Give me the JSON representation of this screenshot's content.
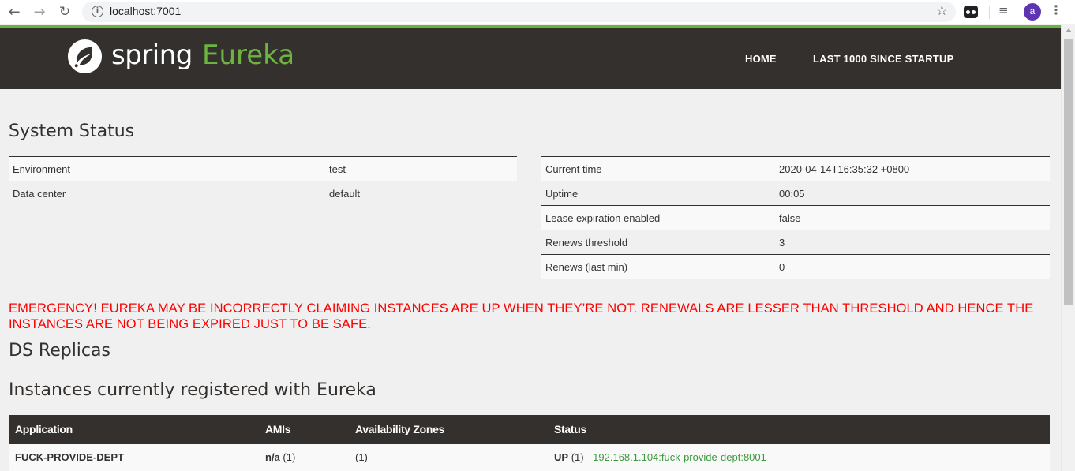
{
  "browser": {
    "url": "localhost:7001",
    "avatar_letter": "a",
    "icons": [
      "back-arrow-icon",
      "forward-arrow-icon",
      "reload-icon",
      "info-icon",
      "star-icon",
      "extension-icon",
      "media-queue-icon",
      "menu-kebab-icon"
    ]
  },
  "header": {
    "logo_spring": "spring",
    "logo_eureka": "Eureka",
    "nav": {
      "home": "HOME",
      "last1000": "LAST 1000 SINCE STARTUP"
    }
  },
  "colors": {
    "brand_green": "#6db33f",
    "header_bg": "#34302d",
    "emergency_red": "#ff0000",
    "link_green": "#3d9b3d"
  },
  "system_status": {
    "title": "System Status",
    "left": [
      {
        "key": "Environment",
        "value": "test"
      },
      {
        "key": "Data center",
        "value": "default"
      }
    ],
    "right": [
      {
        "key": "Current time",
        "value": "2020-04-14T16:35:32 +0800"
      },
      {
        "key": "Uptime",
        "value": "00:05"
      },
      {
        "key": "Lease expiration enabled",
        "value": "false"
      },
      {
        "key": "Renews threshold",
        "value": "3"
      },
      {
        "key": "Renews (last min)",
        "value": "0"
      }
    ]
  },
  "emergency": "EMERGENCY! EUREKA MAY BE INCORRECTLY CLAIMING INSTANCES ARE UP WHEN THEY’RE NOT. RENEWALS ARE LESSER THAN THRESHOLD AND HENCE THE INSTANCES ARE NOT BEING EXPIRED JUST TO BE SAFE.",
  "ds_replicas": {
    "title": "DS Replicas"
  },
  "instances": {
    "title": "Instances currently registered with Eureka",
    "columns": [
      "Application",
      "AMIs",
      "Availability Zones",
      "Status"
    ],
    "rows": [
      {
        "application": "FUCK-PROVIDE-DEPT",
        "amis_label": "n/a",
        "amis_count": "(1)",
        "zones": "(1)",
        "status_label": "UP",
        "status_count": "(1) -",
        "instance_link": "192.168.1.104:fuck-provide-dept:8001"
      }
    ]
  }
}
